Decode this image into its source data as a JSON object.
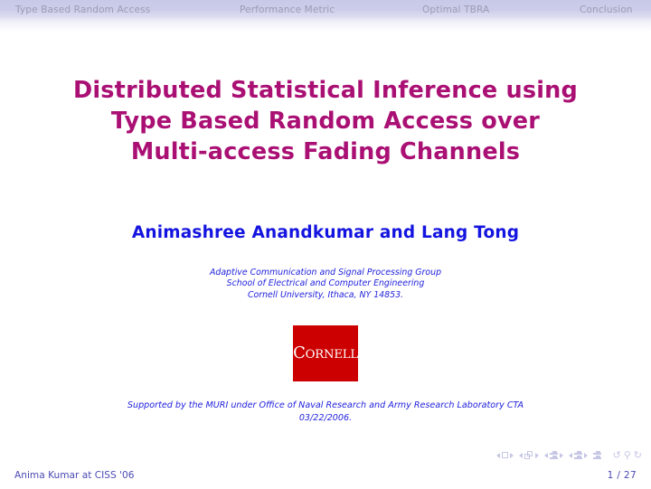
{
  "nav": {
    "items": [
      {
        "label": "Type Based Random Access"
      },
      {
        "label": "Performance Metric"
      },
      {
        "label": "Optimal TBRA"
      },
      {
        "label": "Conclusion"
      }
    ]
  },
  "title": {
    "lines": [
      "Distributed Statistical Inference using",
      "Type Based Random Access over",
      "Multi-access Fading Channels"
    ],
    "color": "#aa1074"
  },
  "authors": {
    "text": "Animashree Anandkumar and Lang Tong",
    "color": "#1414e0"
  },
  "affiliation": {
    "lines": [
      "Adaptive Communication and Signal Processing Group",
      "School of Electrical and Computer Engineering",
      "Cornell University, Ithaca, NY 14853."
    ],
    "color": "#2222dd"
  },
  "logo": {
    "name": "cornell-logo",
    "word_first": "C",
    "word_rest": "ORNELL",
    "background": "#cc0000",
    "text_color": "#ffffff"
  },
  "support": {
    "lines": [
      "Supported by the MURI under Office of Naval Research and Army Research Laboratory CTA",
      "03/22/2006."
    ],
    "color": "#2222dd"
  },
  "nav_symbols": {
    "slide_icon": "square-icon",
    "frame_icon": "stacked-squares-icon",
    "subsection_icon": "subsection-bars-icon",
    "section_icon": "section-bars-icon",
    "doc_icon": "document-bars-icon",
    "back_icon": "back-arrow-icon",
    "search_icon": "search-icon",
    "forward_icon": "forward-arrow-icon",
    "color": "#c4c4e4"
  },
  "footer": {
    "left": "Anima Kumar at CISS '06",
    "right": "1 / 27",
    "color": "#4b4bb4"
  }
}
